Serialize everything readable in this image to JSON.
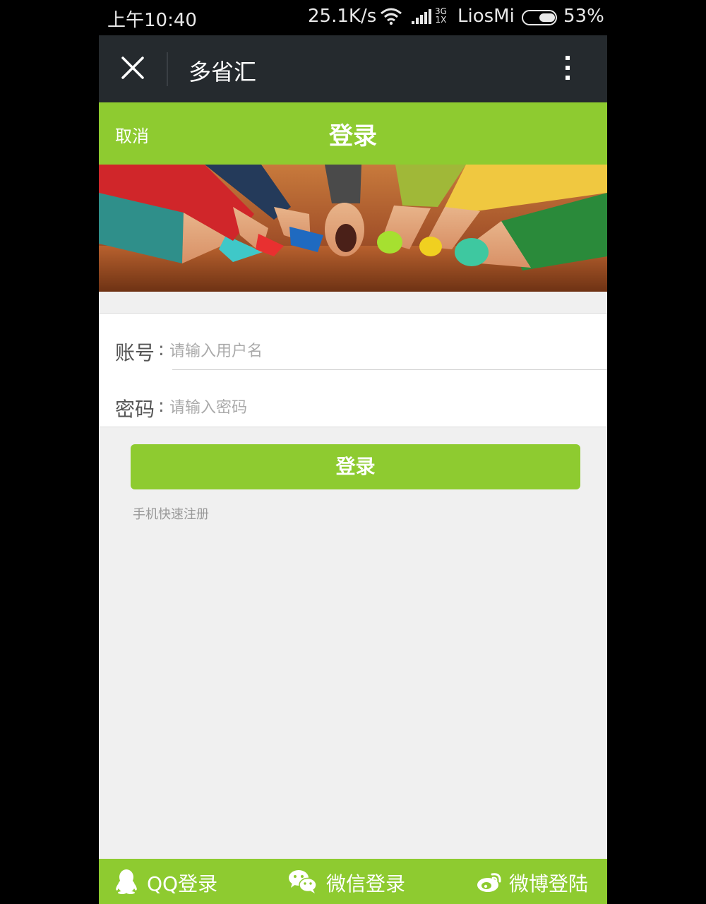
{
  "status_bar": {
    "time": "上午10:40",
    "network_speed": "25.1K/s",
    "network_type_top": "3G",
    "network_type_bottom": "1X",
    "carrier": "LiosMi",
    "battery_percent": "53%",
    "battery_level": 0.53,
    "icons": [
      "wifi-icon",
      "signal-icon",
      "battery-icon"
    ]
  },
  "browser_header": {
    "title": "多省汇",
    "close_icon": "close-icon",
    "more_icon": "more-vertical-icon"
  },
  "page_header": {
    "cancel_label": "取消",
    "title": "登录"
  },
  "banner": {
    "icon": "colored-pencils-image"
  },
  "form": {
    "account_label": "账号",
    "account_placeholder": "请输入用户名",
    "account_value": "",
    "password_label": "密码",
    "password_placeholder": "请输入密码",
    "password_value": "",
    "colon": ":"
  },
  "actions": {
    "login_button": "登录",
    "register_link": "手机快速注册"
  },
  "social_login": {
    "qq_label": "QQ登录",
    "wechat_label": "微信登录",
    "weibo_label": "微博登陆"
  },
  "colors": {
    "accent_green": "#8ecb30",
    "browser_header_bg": "#252a2e",
    "page_bg": "#f0f0f0"
  }
}
